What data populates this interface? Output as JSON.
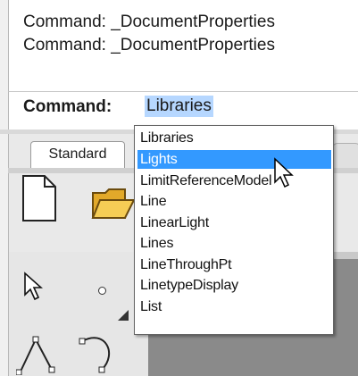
{
  "history": {
    "lines": [
      "Command: _DocumentProperties",
      "Command: _DocumentProperties"
    ]
  },
  "command": {
    "label": "Command:",
    "value": "Libraries"
  },
  "toolbar": {
    "active_tab": "Standard"
  },
  "autocomplete": {
    "items": [
      "Libraries",
      "Lights",
      "LimitReferenceModel",
      "Line",
      "LinearLight",
      "Lines",
      "LineThroughPt",
      "LinetypeDisplay",
      "List"
    ],
    "selected_index": 1
  },
  "colors": {
    "selection": "#3399ff",
    "command_highlight": "#b6d7ff"
  },
  "icons": [
    "new-document-icon",
    "open-folder-icon",
    "select-arrow-icon",
    "point-icon",
    "curve-tool-icon",
    "mouse-pointer-icon"
  ]
}
